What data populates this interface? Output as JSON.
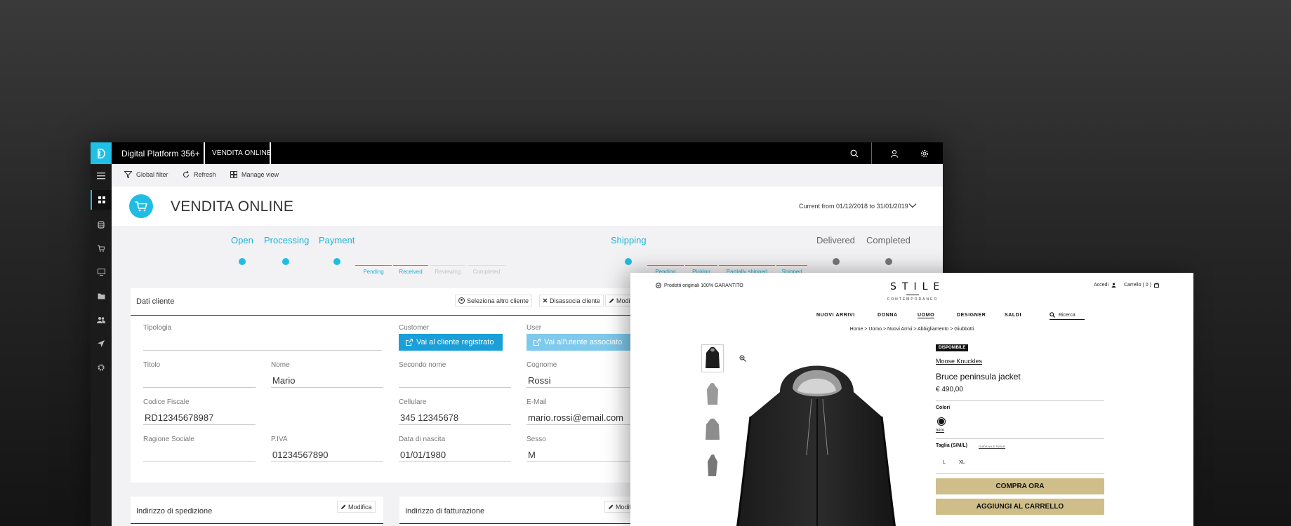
{
  "admin": {
    "app_title": "Digital Platform 356+",
    "app_tab": "VENDITA ONLINE",
    "toolbar": {
      "global_filter": "Global filter",
      "refresh": "Refresh",
      "manage_view": "Manage view"
    },
    "header": {
      "title": "VENDITA ONLINE",
      "period": "Current  from 01/12/2018 to 31/01/2019"
    },
    "status": {
      "steps": [
        "Open",
        "Processing",
        "Payment",
        "Shipping",
        "Delivered",
        "Completed"
      ],
      "payment_substeps": [
        "Pending",
        "Received",
        "Reviewing",
        "Completed"
      ],
      "shipping_substeps": [
        "Pending",
        "Picking",
        "Partially shipped",
        "Shipped"
      ]
    },
    "customer_card": {
      "title": "Dati cliente",
      "actions": [
        "Seleziona altro cliente",
        "Disassocia cliente",
        "Modifica"
      ],
      "labels": {
        "tipologia": "Tipologia",
        "customer": "Customer",
        "user": "User",
        "titolo": "Titolo",
        "nome": "Nome",
        "secondo_nome": "Secondo nome",
        "cognome": "Cognome",
        "codice_fiscale": "Codice Fiscale",
        "cellulare": "Cellulare",
        "email": "E-Mail",
        "ragione_sociale": "Ragione Sociale",
        "piva": "P.IVA",
        "data_nascita": "Data di nascita",
        "sesso": "Sesso"
      },
      "values": {
        "tipologia": "",
        "titolo": "",
        "nome": "Mario",
        "secondo_nome": "",
        "cognome": "Rossi",
        "codice_fiscale": "RD12345678987",
        "cellulare": "345 12345678",
        "email": "mario.rossi@email.com",
        "ragione_sociale": "",
        "piva": "01234567890",
        "data_nascita": "01/01/1980",
        "sesso": "M"
      },
      "customer_link": "Vai al cliente registrato",
      "user_link": "Vai all'utente associato"
    },
    "shipping_card": {
      "title": "Indirizzo di spedizione",
      "action": "Modifica"
    },
    "billing_card": {
      "title": "Indirizzo di fatturazione",
      "action": "Modifica"
    },
    "colors": {
      "accent": "#1fbde4",
      "link_primary": "#1a9fd8",
      "link_secondary": "#7ec9ec"
    }
  },
  "shop": {
    "guarantee": "Prodotti originali 100% GARANTITO",
    "brand": "STILE",
    "brand_sub": "CONTEMPORANEO",
    "login": "Accedi",
    "cart": "Carrello ( 0 )",
    "nav": [
      "NUOVI ARRIVI",
      "DONNA",
      "UOMO",
      "DESIGNER",
      "SALDI"
    ],
    "search": "Ricerca",
    "breadcrumb": "Home  >  Uomo  >  Nuovi Arrivi  >  Abbigliamento  >  Giubbotti",
    "product": {
      "badge": "DISPONIBILE",
      "designer": "Moose Knuckles",
      "name": "Bruce peninsula jacket",
      "price": "€ 490,00",
      "colors_label": "Colori",
      "color_name": "nero",
      "size_label": "Taglia (S/M/L)",
      "size_guide": "GUIDA ALLE TAGLIE",
      "sizes": [
        "L",
        "XL"
      ],
      "buy_now": "COMPRA ORA",
      "add_to_cart": "AGGIUNGI AL CARRELLO"
    },
    "colors": {
      "button": "#cfbe8a"
    }
  }
}
